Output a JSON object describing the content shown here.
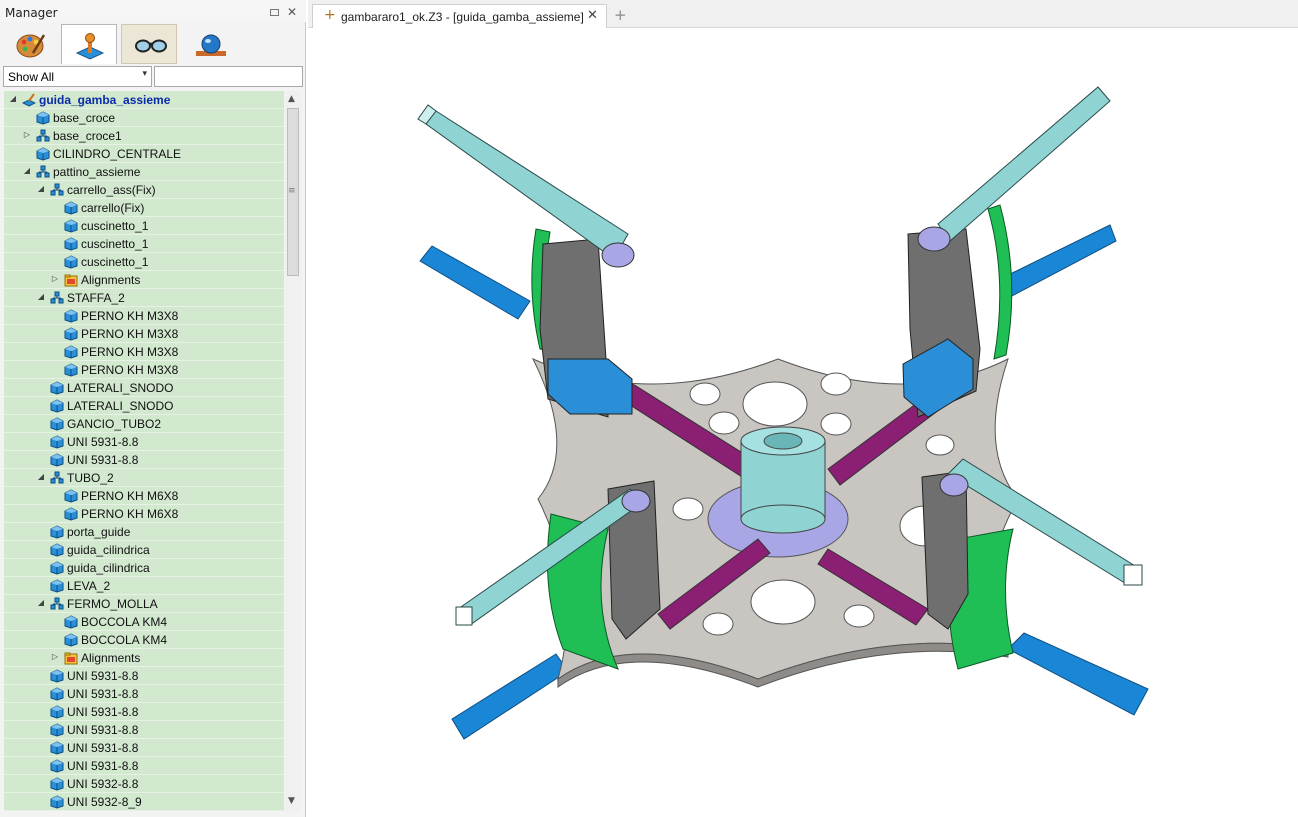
{
  "manager": {
    "title": "Manager",
    "tabs": [
      "paint-palette-icon",
      "assembly-joystick-icon",
      "glasses-icon",
      "globe-icon"
    ],
    "filter": {
      "selected": "Show All",
      "search_value": ""
    }
  },
  "tree": {
    "rows": [
      {
        "label": "guida_gamba_assieme",
        "level": 0,
        "expander": "expanded",
        "icon": "assembly-root-icon"
      },
      {
        "label": "base_croce",
        "level": 1,
        "expander": "none",
        "icon": "part-cube-icon"
      },
      {
        "label": "base_croce1",
        "level": 1,
        "expander": "collapsed",
        "icon": "subassembly-icon"
      },
      {
        "label": "CILINDRO_CENTRALE",
        "level": 1,
        "expander": "none",
        "icon": "part-cube-icon"
      },
      {
        "label": "pattino_assieme",
        "level": 1,
        "expander": "expanded",
        "icon": "subassembly-icon"
      },
      {
        "label": "carrello_ass(Fix)",
        "level": 2,
        "expander": "expanded",
        "icon": "subassembly-icon"
      },
      {
        "label": "carrello(Fix)",
        "level": 3,
        "expander": "none",
        "icon": "part-cube-icon"
      },
      {
        "label": "cuscinetto_1",
        "level": 3,
        "expander": "none",
        "icon": "part-cube-icon"
      },
      {
        "label": "cuscinetto_1",
        "level": 3,
        "expander": "none",
        "icon": "part-cube-icon"
      },
      {
        "label": "cuscinetto_1",
        "level": 3,
        "expander": "none",
        "icon": "part-cube-icon"
      },
      {
        "label": "Alignments",
        "level": 3,
        "expander": "collapsed",
        "icon": "folder-icon"
      },
      {
        "label": "STAFFA_2",
        "level": 2,
        "expander": "expanded",
        "icon": "subassembly-icon"
      },
      {
        "label": "PERNO KH M3X8",
        "level": 3,
        "expander": "none",
        "icon": "part-cube-icon"
      },
      {
        "label": "PERNO KH M3X8",
        "level": 3,
        "expander": "none",
        "icon": "part-cube-icon"
      },
      {
        "label": "PERNO KH M3X8",
        "level": 3,
        "expander": "none",
        "icon": "part-cube-icon"
      },
      {
        "label": "PERNO KH M3X8",
        "level": 3,
        "expander": "none",
        "icon": "part-cube-icon"
      },
      {
        "label": "LATERALI_SNODO",
        "level": 2,
        "expander": "none",
        "icon": "part-cube-icon"
      },
      {
        "label": "LATERALI_SNODO",
        "level": 2,
        "expander": "none",
        "icon": "part-cube-icon"
      },
      {
        "label": "GANCIO_TUBO2",
        "level": 2,
        "expander": "none",
        "icon": "part-cube-icon"
      },
      {
        "label": "UNI 5931-8.8",
        "level": 2,
        "expander": "none",
        "icon": "part-cube-icon"
      },
      {
        "label": "UNI 5931-8.8",
        "level": 2,
        "expander": "none",
        "icon": "part-cube-icon"
      },
      {
        "label": "TUBO_2",
        "level": 2,
        "expander": "expanded",
        "icon": "subassembly-icon"
      },
      {
        "label": "PERNO KH M6X8",
        "level": 3,
        "expander": "none",
        "icon": "part-cube-icon"
      },
      {
        "label": "PERNO KH M6X8",
        "level": 3,
        "expander": "none",
        "icon": "part-cube-icon"
      },
      {
        "label": "porta_guide",
        "level": 2,
        "expander": "none",
        "icon": "part-cube-icon"
      },
      {
        "label": "guida_cilindrica",
        "level": 2,
        "expander": "none",
        "icon": "part-cube-icon"
      },
      {
        "label": "guida_cilindrica",
        "level": 2,
        "expander": "none",
        "icon": "part-cube-icon"
      },
      {
        "label": "LEVA_2",
        "level": 2,
        "expander": "none",
        "icon": "part-cube-icon"
      },
      {
        "label": "FERMO_MOLLA",
        "level": 2,
        "expander": "expanded",
        "icon": "subassembly-icon"
      },
      {
        "label": "BOCCOLA KM4",
        "level": 3,
        "expander": "none",
        "icon": "part-cube-icon"
      },
      {
        "label": "BOCCOLA KM4",
        "level": 3,
        "expander": "none",
        "icon": "part-cube-icon"
      },
      {
        "label": "Alignments",
        "level": 3,
        "expander": "collapsed",
        "icon": "folder-icon"
      },
      {
        "label": "UNI 5931-8.8",
        "level": 2,
        "expander": "none",
        "icon": "part-cube-icon"
      },
      {
        "label": "UNI 5931-8.8",
        "level": 2,
        "expander": "none",
        "icon": "part-cube-icon"
      },
      {
        "label": "UNI 5931-8.8",
        "level": 2,
        "expander": "none",
        "icon": "part-cube-icon"
      },
      {
        "label": "UNI 5931-8.8",
        "level": 2,
        "expander": "none",
        "icon": "part-cube-icon"
      },
      {
        "label": "UNI 5931-8.8",
        "level": 2,
        "expander": "none",
        "icon": "part-cube-icon"
      },
      {
        "label": "UNI 5931-8.8",
        "level": 2,
        "expander": "none",
        "icon": "part-cube-icon"
      },
      {
        "label": "UNI 5932-8.8",
        "level": 2,
        "expander": "none",
        "icon": "part-cube-icon"
      },
      {
        "label": "UNI 5932-8_9",
        "level": 2,
        "expander": "none",
        "icon": "part-cube-icon"
      }
    ]
  },
  "document": {
    "tab_title": "gambararo1_ok.Z3 - [guida_gamba_assieme]",
    "tab_close": "✕",
    "new_tab": "+"
  },
  "colors": {
    "tree_bg": "#d2e9cf",
    "root_label": "#0a2aa8",
    "plate": "#c9c6c2",
    "tube": "#8fd3d3",
    "blue_strip": "#1a86d6",
    "green_shield": "#1fbf56",
    "magenta_rail": "#8a1f74",
    "bracket": "#6f6f6f"
  }
}
